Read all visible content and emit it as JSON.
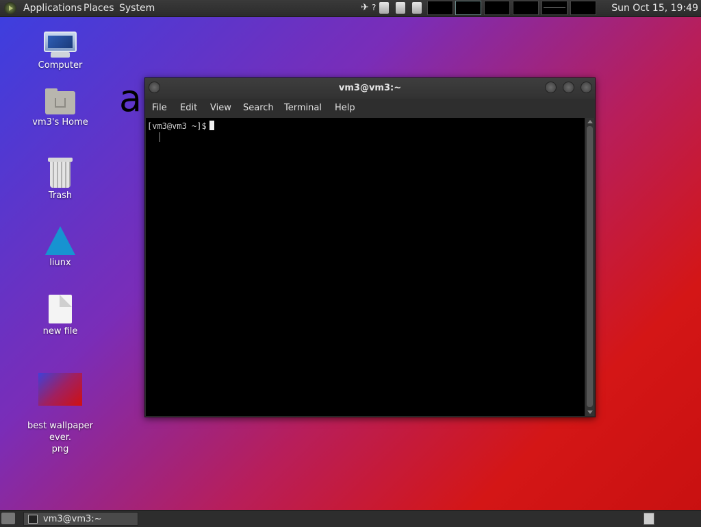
{
  "top_panel": {
    "menus": [
      "Applications",
      "Places",
      "System"
    ],
    "clock": "Sun Oct 15, 19:49"
  },
  "desktop": {
    "icons": [
      {
        "label": "Computer",
        "icon": "computer-icon"
      },
      {
        "label": "vm3's Home",
        "icon": "home-folder-icon"
      },
      {
        "label": "Trash",
        "icon": "trash-icon"
      },
      {
        "label": "liunx",
        "icon": "arch-linux-icon"
      },
      {
        "label": "new file",
        "icon": "file-icon"
      },
      {
        "label": "best wallpaper ever.\npng",
        "icon": "image-thumbnail-icon"
      }
    ],
    "big_text": "a"
  },
  "terminal": {
    "title": "vm3@vm3:~",
    "menu": [
      "File",
      "Edit",
      "View",
      "Search",
      "Terminal",
      "Help"
    ],
    "prompt": "[vm3@vm3 ~]$"
  },
  "bottom_panel": {
    "task_label": "vm3@vm3:~"
  }
}
